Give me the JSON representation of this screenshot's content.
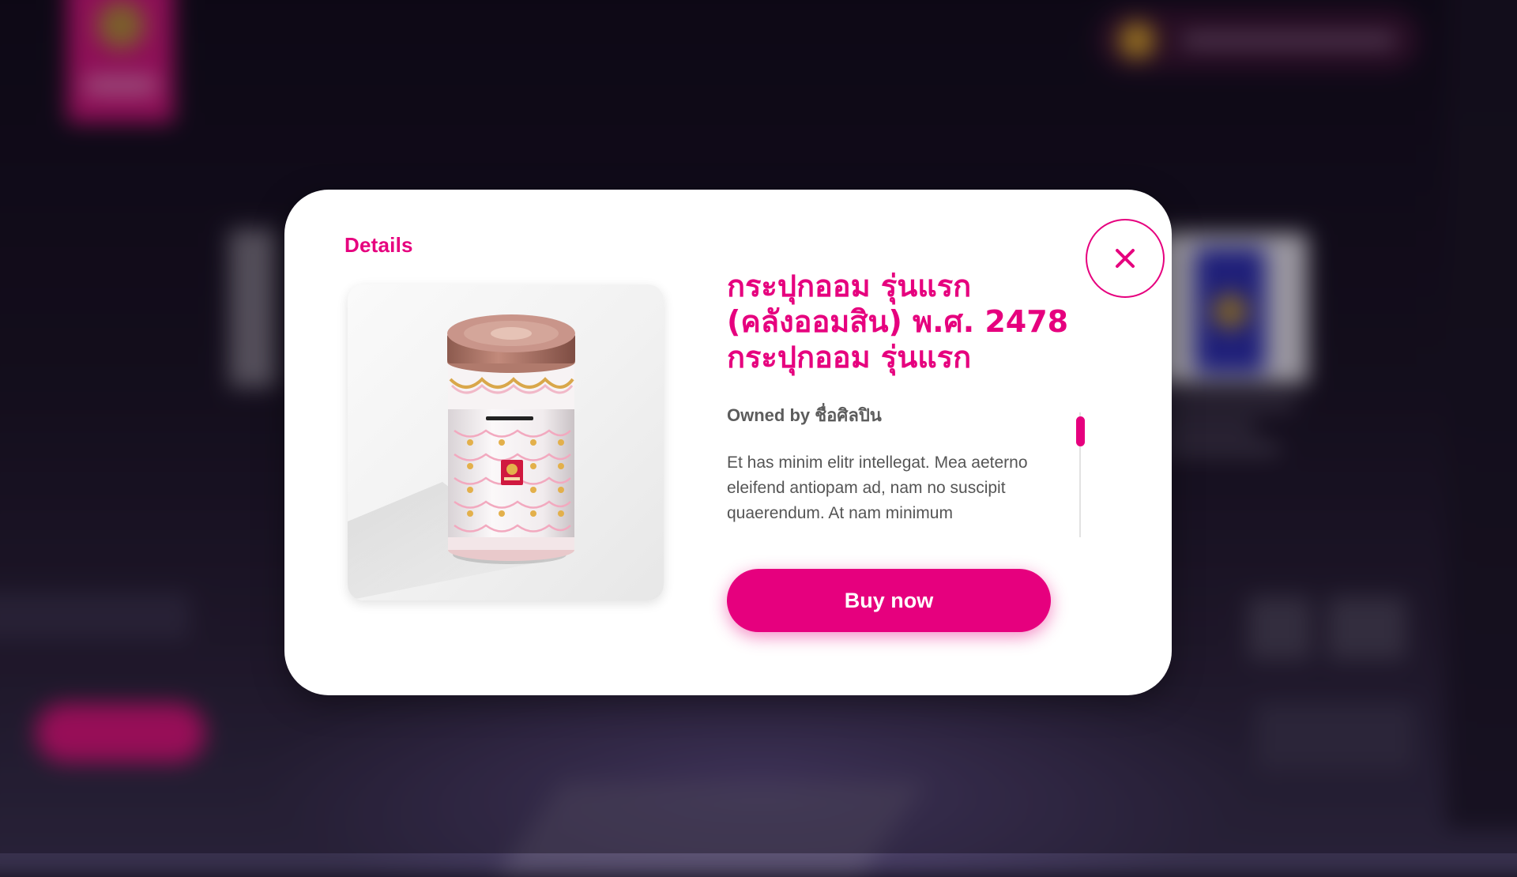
{
  "modal": {
    "heading": "Details",
    "title_lines": [
      "กระปุกออม รุ่นแรก",
      "(คลังออมสิน) พ.ศ. 2478",
      "กระปุกออม รุ่นแรก"
    ],
    "owner_prefix": "Owned by",
    "owner_name": "ชื่อศิลปิน",
    "description": "Et has minim elitr intellegat. Mea aeterno eleifend antiopam ad, nam no suscipit quaerendum. At nam minimum",
    "buy_label": "Buy now",
    "close_icon": "close-icon",
    "product_image": "piggy-bank-tin-image"
  },
  "colors": {
    "accent": "#e6007e",
    "text_muted": "#5c5c5c",
    "modal_bg": "#ffffff"
  }
}
